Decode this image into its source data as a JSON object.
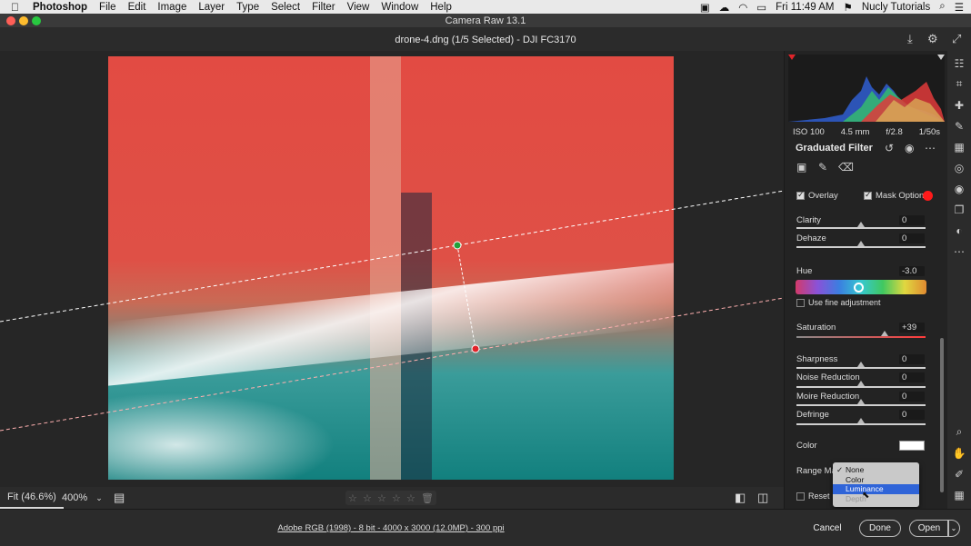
{
  "menubar": {
    "app": "Photoshop",
    "items": [
      "File",
      "Edit",
      "Image",
      "Layer",
      "Type",
      "Select",
      "Filter",
      "View",
      "Window",
      "Help"
    ],
    "clock": "Fri 11:49 AM",
    "user": "Nucly Tutorials"
  },
  "window": {
    "title": "Camera Raw 13.1",
    "document": "drone-4.dng (1/5 Selected)  -  DJI FC3170"
  },
  "zoom": {
    "fit": "Fit (46.6%)",
    "level": "400%"
  },
  "rating": {
    "stars": 5,
    "filled": 0
  },
  "exif": {
    "iso": "ISO 100",
    "focal": "4.5 mm",
    "aperture": "f/2.8",
    "shutter": "1/50s"
  },
  "panel": {
    "title": "Graduated Filter",
    "overlay_label": "Overlay",
    "overlay_checked": true,
    "mask_options_label": "Mask Options",
    "mask_color": "#ff1a1a",
    "sliders": [
      {
        "label": "Clarity",
        "value": "0",
        "pos": 0.5
      },
      {
        "label": "Dehaze",
        "value": "0",
        "pos": 0.5
      }
    ],
    "hue": {
      "label": "Hue",
      "value": "-3.0",
      "pos": 0.49
    },
    "fine_adjust_label": "Use fine adjustment",
    "saturation": {
      "label": "Saturation",
      "value": "+39",
      "pos": 0.695
    },
    "sliders2": [
      {
        "label": "Sharpness",
        "value": "0",
        "pos": 0.5
      },
      {
        "label": "Noise Reduction",
        "value": "0",
        "pos": 0.5
      },
      {
        "label": "Moire Reduction",
        "value": "0",
        "pos": 0.5
      },
      {
        "label": "Defringe",
        "value": "0",
        "pos": 0.5
      }
    ],
    "color_label": "Color",
    "range_mask_label": "Range Mask",
    "reset_label": "Reset"
  },
  "dropdown": {
    "options": [
      {
        "label": "None",
        "checked": true,
        "selected": false,
        "disabled": false
      },
      {
        "label": "Color",
        "checked": false,
        "selected": false,
        "disabled": false
      },
      {
        "label": "Luminance",
        "checked": false,
        "selected": true,
        "disabled": false
      },
      {
        "label": "Depth",
        "checked": false,
        "selected": false,
        "disabled": true
      }
    ]
  },
  "footer": {
    "info": "Adobe RGB (1998) - 8 bit - 4000 x 3000 (12.0MP) - 300 ppi",
    "cancel": "Cancel",
    "done": "Done",
    "open": "Open"
  },
  "icons": {
    "histogram_warning": "clipping-warning-icon",
    "tools": [
      "edit-icon",
      "crop-icon",
      "healing-icon",
      "brush-icon",
      "graduated-filter-icon",
      "radial-filter-icon",
      "redeye-icon",
      "snapshots-icon",
      "presets-icon",
      "more-icon",
      "zoom-icon",
      "hand-icon",
      "sampler-icon",
      "grid-icon"
    ]
  }
}
